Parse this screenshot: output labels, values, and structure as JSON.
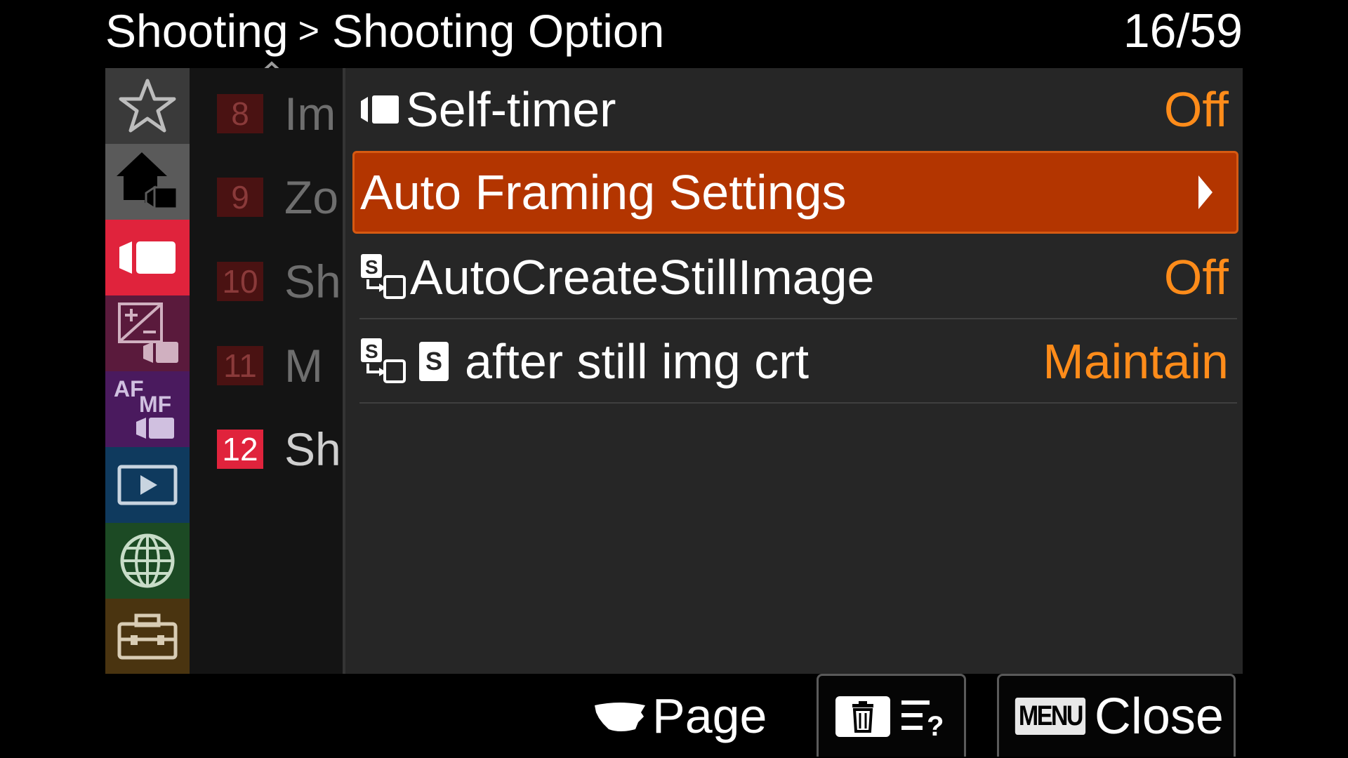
{
  "header": {
    "breadcrumb_parent": "Shooting",
    "breadcrumb_separator": ">",
    "breadcrumb_current": "Shooting Option",
    "page_counter": "16/59"
  },
  "categories": [
    {
      "icon": "star-icon",
      "color": "#3a3a3a"
    },
    {
      "icon": "home-movie-icon",
      "color": "#5a5a5a"
    },
    {
      "icon": "movie-camera-icon",
      "color": "#e0233c",
      "active": true
    },
    {
      "icon": "exposure-color-icon",
      "color": "#5a1a3c"
    },
    {
      "icon": "af-mf-icon",
      "color": "#4a1a5e"
    },
    {
      "icon": "playback-icon",
      "color": "#0f3a5e"
    },
    {
      "icon": "network-globe-icon",
      "color": "#1c4a24"
    },
    {
      "icon": "toolbox-icon",
      "color": "#4a3410"
    }
  ],
  "groups": [
    {
      "number": "8",
      "name": "Im",
      "active": false
    },
    {
      "number": "9",
      "name": "Zo",
      "active": false
    },
    {
      "number": "10",
      "name": "Sh",
      "active": false
    },
    {
      "number": "11",
      "name": "M",
      "active": false
    },
    {
      "number": "12",
      "name": "Sh",
      "active": true
    }
  ],
  "items": [
    {
      "label": "Self-timer",
      "value": "Off",
      "icon": "movie-mode-icon"
    },
    {
      "label": "Auto Framing Settings",
      "value": "",
      "selected": true
    },
    {
      "label": "AutoCreateStillImage",
      "value": "Off",
      "icon": "still-from-movie-icon"
    },
    {
      "label": "after still img crt",
      "value": "Maintain",
      "icon": "still-from-movie-icon",
      "badge": "S"
    }
  ],
  "footer": {
    "page_label": "Page",
    "close_label": "Close",
    "menu_badge": "MENU"
  },
  "colors": {
    "accent_selected": "#b33500",
    "value_orange": "#ff8c1a",
    "active_group": "#e0233c"
  }
}
